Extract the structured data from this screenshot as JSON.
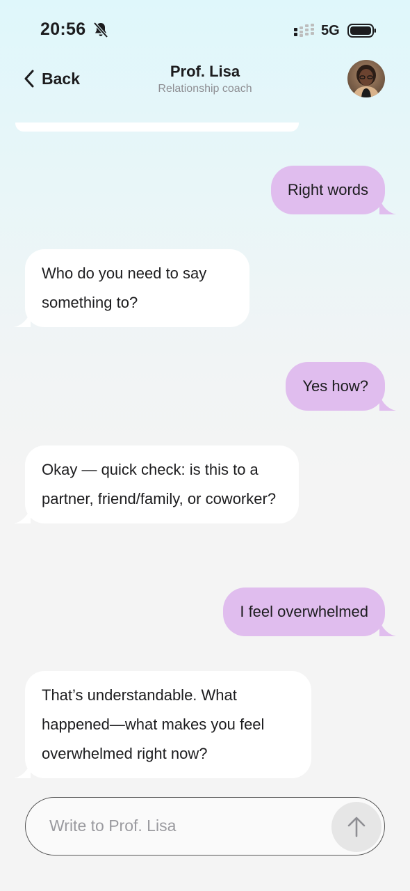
{
  "status_bar": {
    "time": "20:56",
    "network": "5G",
    "icons": [
      "bell-slash-icon",
      "signal-icon",
      "battery-icon"
    ]
  },
  "header": {
    "back_label": "Back",
    "title": "Prof. Lisa",
    "subtitle": "Relationship coach"
  },
  "messages": [
    {
      "role": "user",
      "text": "Right words"
    },
    {
      "role": "bot",
      "text": "Who do you need to say something to?"
    },
    {
      "role": "user",
      "text": "Yes how?"
    },
    {
      "role": "bot",
      "text": "Okay — quick check: is this to a partner, friend/family, or coworker?"
    },
    {
      "role": "user",
      "text": "I feel overwhelmed"
    },
    {
      "role": "bot",
      "text": "That’s understandable. What happened—what makes you feel overwhelmed right now?"
    }
  ],
  "composer": {
    "placeholder": "Write to Prof. Lisa",
    "send_icon": "arrow-up-icon"
  },
  "colors": {
    "user_bubble": "#e0bdee",
    "bot_bubble": "#ffffff",
    "background_top": "#dff7fb",
    "background_bottom": "#f4f4f4"
  }
}
